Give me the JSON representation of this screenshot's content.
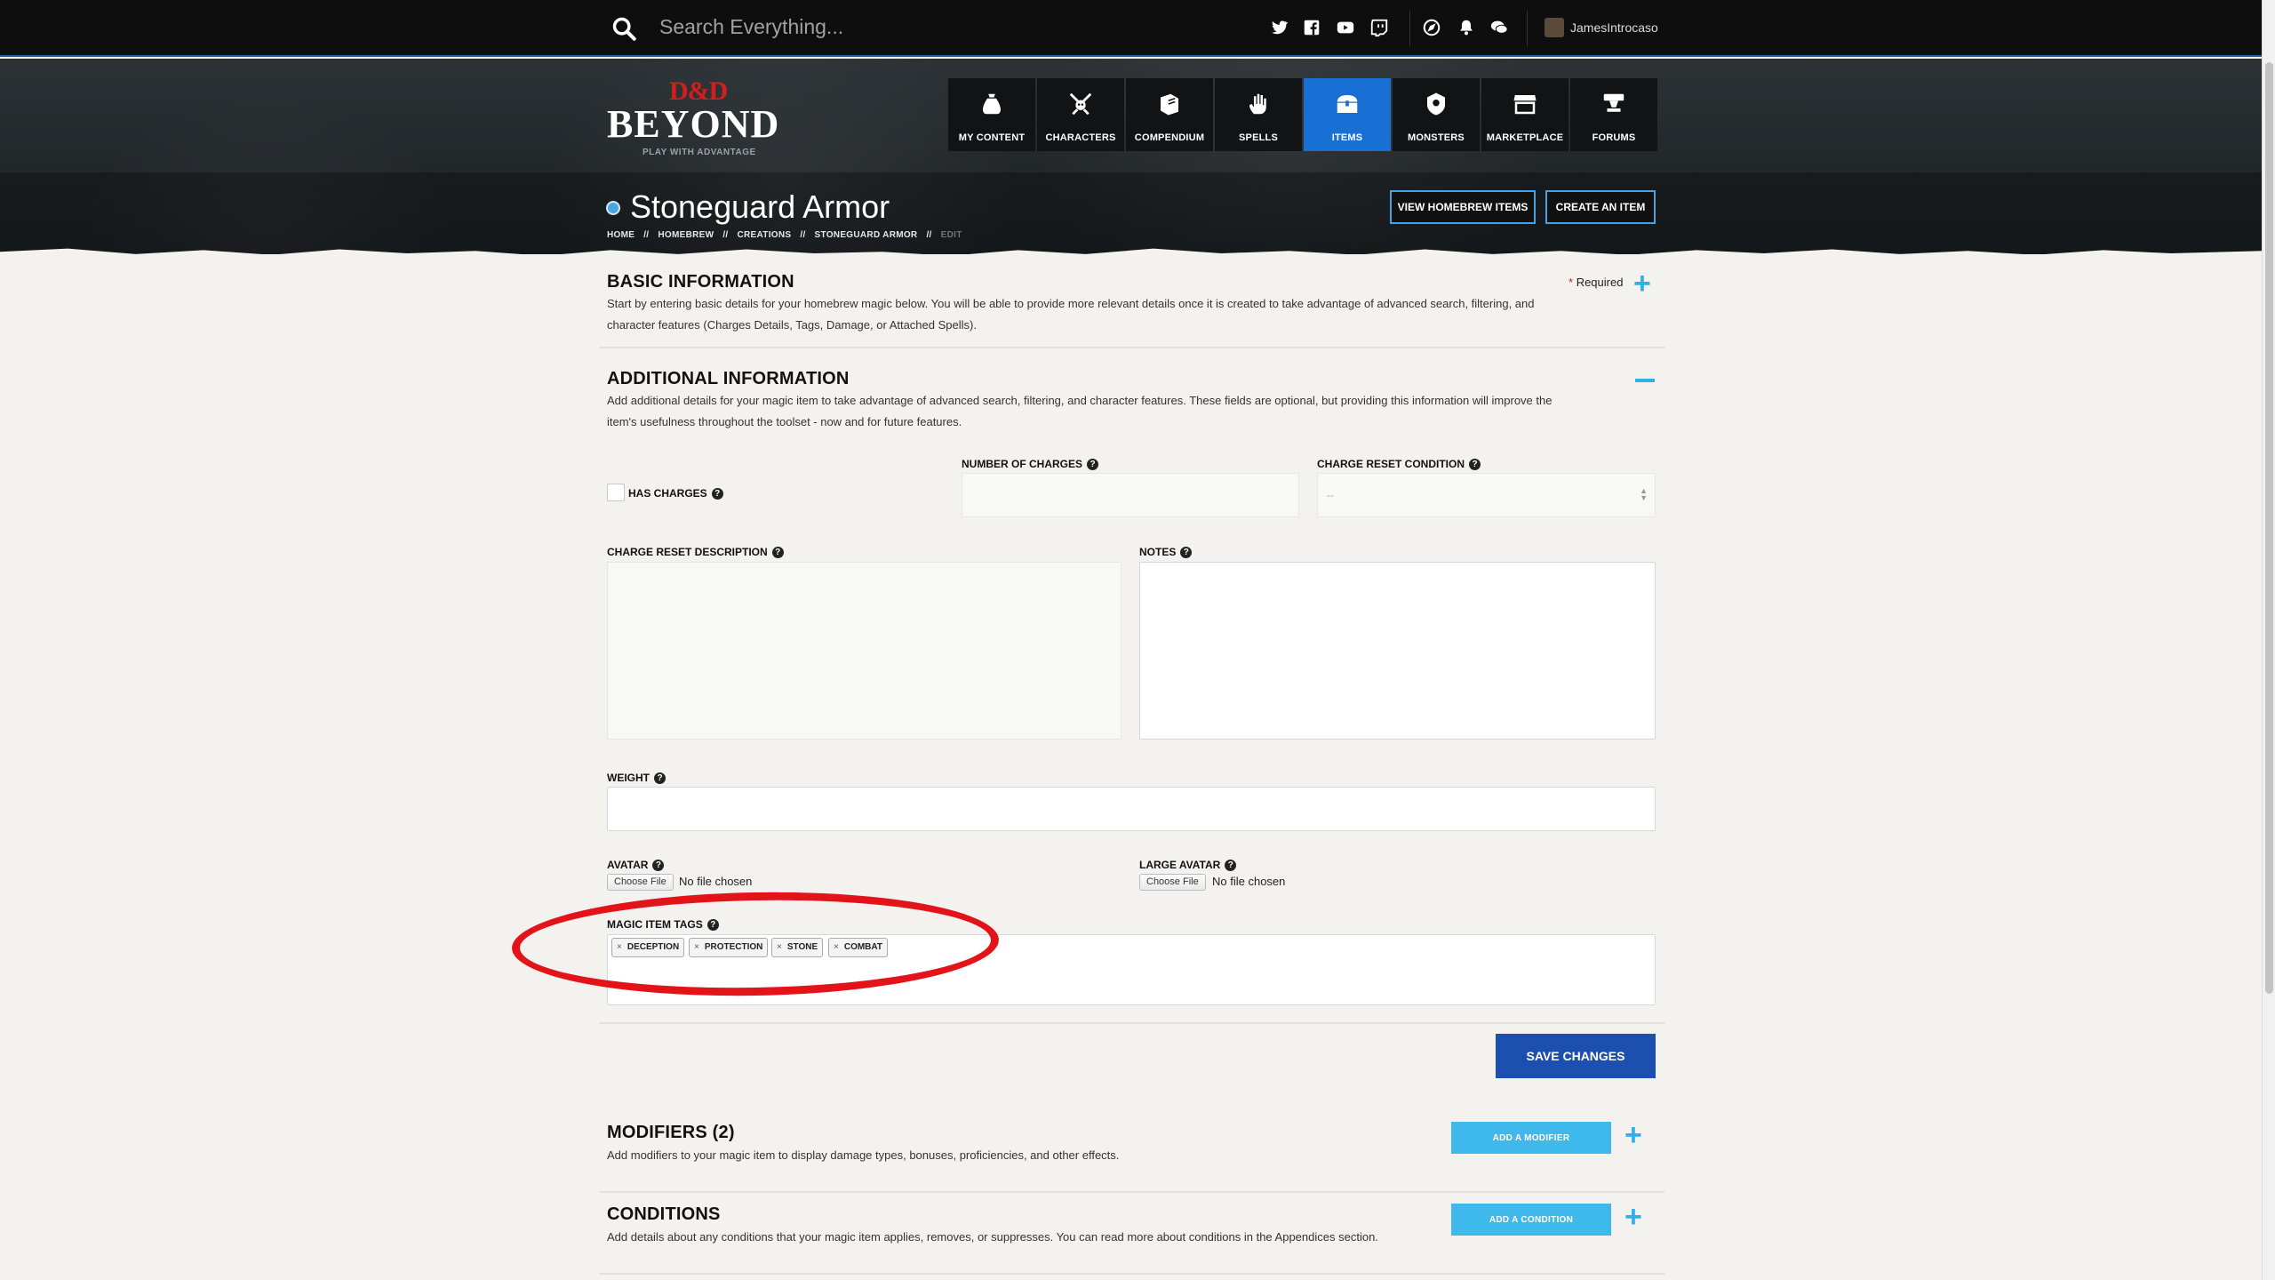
{
  "topbar": {
    "search_placeholder": "Search Everything...",
    "username": "JamesIntrocaso"
  },
  "logo": {
    "dd": "D&D",
    "beyond": "BEYOND",
    "tagline": "PLAY WITH ADVANTAGE"
  },
  "nav": {
    "items": [
      {
        "label": "MY CONTENT",
        "icon": "bag-icon"
      },
      {
        "label": "CHARACTERS",
        "icon": "crossed-swords-skull-icon"
      },
      {
        "label": "COMPENDIUM",
        "icon": "book-icon"
      },
      {
        "label": "SPELLS",
        "icon": "hand-spell-icon"
      },
      {
        "label": "ITEMS",
        "icon": "chest-icon"
      },
      {
        "label": "MONSTERS",
        "icon": "monster-icon"
      },
      {
        "label": "MARKETPLACE",
        "icon": "store-icon"
      },
      {
        "label": "FORUMS",
        "icon": "forum-icon"
      }
    ],
    "active": "ITEMS",
    "active_color": "#1870d5"
  },
  "page": {
    "title": "Stoneguard Armor",
    "breadcrumb": [
      "HOME",
      "HOMEBREW",
      "CREATIONS",
      "STONEGUARD ARMOR",
      "EDIT"
    ],
    "view_homebrew_label": "VIEW HOMEBREW ITEMS",
    "create_item_label": "CREATE AN ITEM"
  },
  "basic": {
    "title": "BASIC INFORMATION",
    "required_star": "*",
    "required_label": "Required",
    "desc_line1": "Start by entering basic details for your homebrew magic below. You will be able to provide more relevant details once it is created to take advantage of advanced search, filtering, and",
    "desc_line2": "character features (Charges Details, Tags, Damage, or Attached Spells)."
  },
  "additional": {
    "title": "ADDITIONAL INFORMATION",
    "desc_line1": "Add additional details for your magic item to take advantage of advanced search, filtering, and character features. These fields are optional, but providing this information will improve the",
    "desc_line2": "item's usefulness throughout the toolset - now and for future features.",
    "has_charges_label": "HAS CHARGES",
    "number_of_charges_label": "NUMBER OF CHARGES",
    "charge_reset_condition_label": "CHARGE RESET CONDITION",
    "charge_reset_condition_value": "--",
    "charge_reset_description_label": "CHARGE RESET DESCRIPTION",
    "notes_label": "NOTES",
    "weight_label": "WEIGHT",
    "avatar_label": "AVATAR",
    "large_avatar_label": "LARGE AVATAR",
    "choose_file_label": "Choose File",
    "no_file_label": "No file chosen",
    "magic_item_tags_label": "MAGIC ITEM TAGS",
    "tags": [
      "DECEPTION",
      "PROTECTION",
      "STONE",
      "COMBAT"
    ],
    "save_label": "SAVE CHANGES"
  },
  "modifiers": {
    "title": "MODIFIERS (2)",
    "desc": "Add modifiers to your magic item to display damage types, bonuses, proficiencies, and other effects.",
    "add_label": "ADD A MODIFIER"
  },
  "conditions": {
    "title": "CONDITIONS",
    "desc": "Add details about any conditions that your magic item applies, removes, or suppresses. You can read more about conditions in the Appendices section.",
    "add_label": "ADD A CONDITION"
  },
  "colors": {
    "accent": "#2fb1e6",
    "save_button": "#1d4fb0",
    "annotation": "#e2141a"
  }
}
